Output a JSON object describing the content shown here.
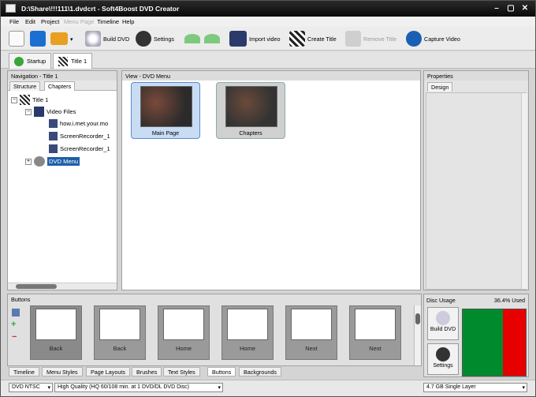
{
  "window": {
    "title": "D:\\Share\\!!!111\\1.dvdcrt - Soft4Boost DVD Creator",
    "min": "–",
    "max": "▢",
    "close": "✕"
  },
  "menu": [
    "File",
    "Edit",
    "Project",
    "Menu Page",
    "Timeline",
    "Help"
  ],
  "toolbar": {
    "build_dvd": "Build DVD",
    "settings": "Settings",
    "import_video": "Import video",
    "create_title": "Create Title",
    "remove_title": "Remove Title",
    "capture_video": "Capture Video"
  },
  "doc_tabs": [
    "Startup",
    "Title 1"
  ],
  "navigation": {
    "header": "Navigation - Title 1",
    "tabs": [
      "Structure",
      "Chapters"
    ],
    "tree": {
      "title": "Title 1",
      "video_files": "Video Files",
      "files": [
        "how.i.met.your.mo",
        "ScreenRecorder_1",
        "ScreenRecorder_1"
      ],
      "dvd_menu": "DVD Menu"
    }
  },
  "view": {
    "header": "View - DVD Menu",
    "thumbs": [
      "Main Page",
      "Chapters"
    ]
  },
  "properties": {
    "header": "Properties",
    "tab": "Design"
  },
  "buttons_panel": {
    "header": "Buttons",
    "cards": [
      "Back",
      "Back",
      "Home",
      "Home",
      "Next",
      "Next"
    ],
    "tabs": [
      "Timeline",
      "Menu Styles",
      "Page Layouts",
      "Brushes",
      "Text Styles",
      "Buttons",
      "Backgrounds"
    ]
  },
  "disc_usage": {
    "header": "Disc Usage",
    "used": "36.4% Used",
    "used_fraction": 0.364,
    "build": "Build DVD",
    "settings": "Settings",
    "colors": {
      "free": "#008a2e",
      "used": "#e60000"
    }
  },
  "status": {
    "format": "DVD NTSC",
    "quality": "High Quality (HQ 60/108 min. at 1 DVD/DL DVD Disc)",
    "disc": "4.7 GB Single Layer"
  }
}
